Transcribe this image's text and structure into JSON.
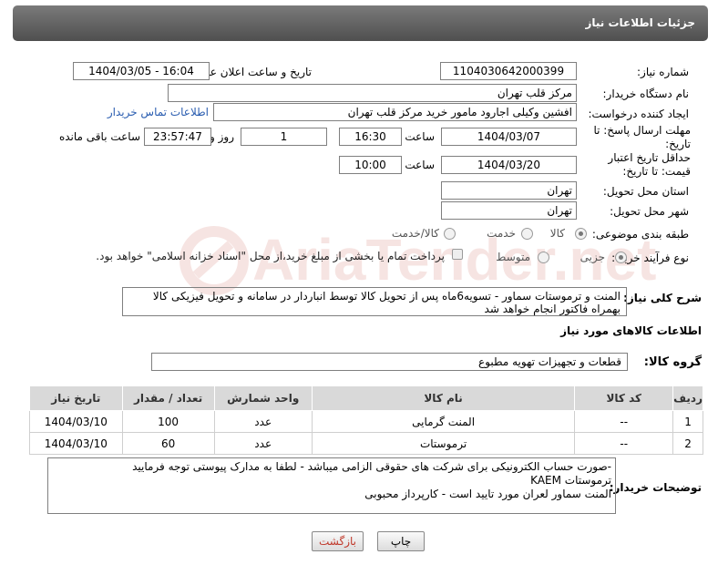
{
  "header": {
    "title": "جزئیات اطلاعات نیاز"
  },
  "fields": {
    "need_number_label": "شماره نیاز:",
    "need_number": "1104030642000399",
    "announce_label": "تاریخ و ساعت اعلان عمومی:",
    "announce_value": "1404/03/05 - 16:04",
    "buyer_org_label": "نام دستگاه خریدار:",
    "buyer_org": "مرکز قلب تهران",
    "requester_label": "ایجاد کننده درخواست:",
    "requester": "افشین وکیلی اجارود مامور خرید مرکز قلب تهران",
    "contact_link": "اطلاعات تماس خریدار",
    "reply_deadline_label": "مهلت ارسال پاسخ: تا تاریخ:",
    "reply_date": "1404/03/07",
    "hour_label": "ساعت",
    "reply_time": "16:30",
    "days_value": "1",
    "days_label": "روز و",
    "remaining_time": "23:57:47",
    "remaining_label": "ساعت باقی مانده",
    "price_validity_label": "حداقل تاریخ اعتبار قیمت: تا تاریخ:",
    "price_date": "1404/03/20",
    "price_time": "10:00",
    "province_label": "استان محل تحویل:",
    "province": "تهران",
    "city_label": "شهر محل تحویل:",
    "city": "تهران",
    "category_label": "طبقه بندی موضوعی:",
    "category_options": [
      "کالا",
      "خدمت",
      "کالا/خدمت"
    ],
    "process_label": "نوع فرآیند خرید :",
    "process_options": [
      "جزیی",
      "متوسط"
    ],
    "payment_note": "پرداخت تمام یا بخشی از مبلغ خرید،از محل \"اسناد خزانه اسلامی\" خواهد بود."
  },
  "description": {
    "label": "شرح کلی نیاز:",
    "text": "المنت و ترموستات سماور - تسویه6ماه پس از تحویل کالا توسط انباردار در سامانه و تحویل فیزیکی کالا بهمراه فاکتور انجام خواهد شد"
  },
  "goods_section": {
    "title": "اطلاعات کالاهای مورد نیاز",
    "group_label": "گروه کالا:",
    "group_value": "قطعات و تجهیزات تهویه مطبوع"
  },
  "table": {
    "headers": [
      "ردیف",
      "کد کالا",
      "نام کالا",
      "واحد شمارش",
      "تعداد / مقدار",
      "تاریخ نیاز"
    ],
    "rows": [
      [
        "1",
        "--",
        "المنت گرمایی",
        "عدد",
        "100",
        "1404/03/10"
      ],
      [
        "2",
        "--",
        "ترموستات",
        "عدد",
        "60",
        "1404/03/10"
      ]
    ]
  },
  "buyer_notes": {
    "label": "توضیحات خریدار:",
    "lines": [
      "-صورت حساب الکترونیکی برای شرکت های حقوقی الزامی میباشد - لطفا به مدارک پیوستی توجه فرمایید",
      "ترموستات KAEM",
      "المنت سماور لعران مورد تایید است - کارپرداز محبوبی"
    ]
  },
  "buttons": {
    "print": "چاپ",
    "back": "بازگشت"
  },
  "watermark": {
    "text": "AriaTender.net"
  },
  "colors": {
    "header_bg": "#5f5f5f",
    "link": "#2a5db0",
    "back_button_text": "#c0392b"
  }
}
